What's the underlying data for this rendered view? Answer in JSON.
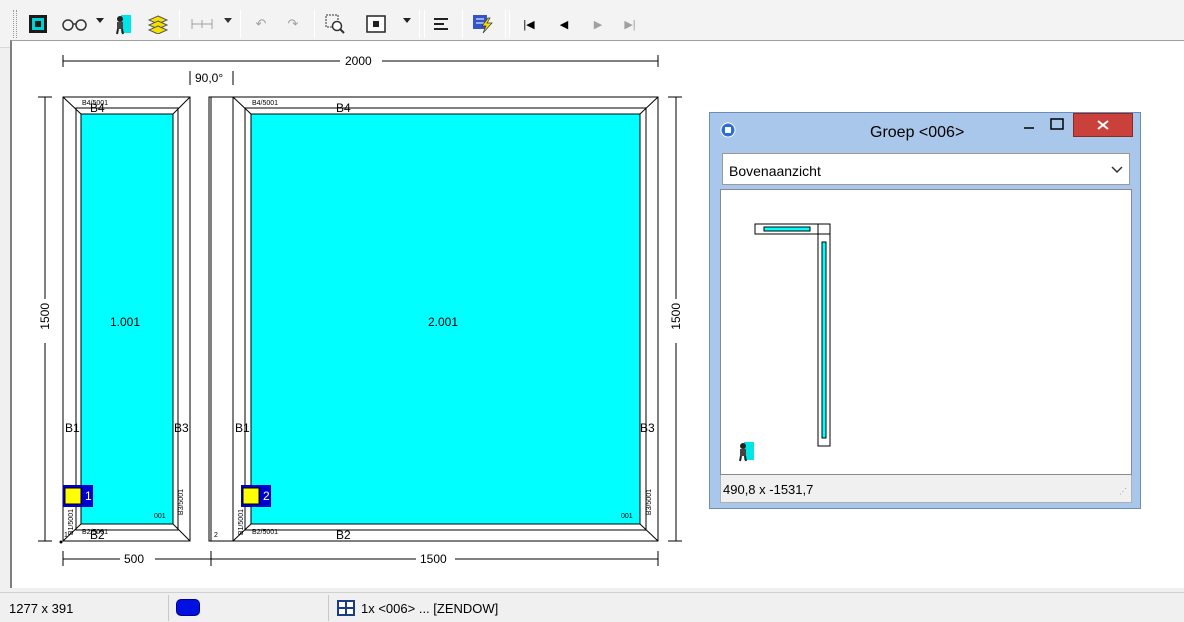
{
  "toolbar": {
    "buttons": [
      {
        "name": "frame-tool-icon",
        "glyph": "▣"
      },
      {
        "name": "glasses-icon",
        "glyph": "∞"
      },
      {
        "name": "person-view-icon",
        "glyph": "♙"
      },
      {
        "name": "layers-icon",
        "glyph": "≋"
      },
      {
        "name": "dimension-icon",
        "glyph": "⟷"
      },
      {
        "name": "undo-icon",
        "glyph": "↶"
      },
      {
        "name": "redo-icon",
        "glyph": "↷"
      },
      {
        "name": "zoom-select-icon",
        "glyph": "⌕"
      },
      {
        "name": "view-mode-icon",
        "glyph": "◘"
      },
      {
        "name": "align-icon",
        "glyph": "≡"
      },
      {
        "name": "calculate-icon",
        "glyph": "ϟ"
      },
      {
        "name": "first-icon",
        "glyph": "⏮"
      },
      {
        "name": "previous-icon",
        "glyph": "◀"
      },
      {
        "name": "next-icon",
        "glyph": "▶"
      },
      {
        "name": "last-icon",
        "glyph": "⏭"
      }
    ]
  },
  "drawing": {
    "dim_total_width": "2000",
    "dim_angle": "90,0°",
    "dim_height_left": "1500",
    "dim_height_right": "1500",
    "dim_width_left": "500",
    "dim_width_right": "1500",
    "panel1": {
      "label": "1.001",
      "b1": "B1",
      "b2": "B2",
      "b3": "B3",
      "b4": "B4",
      "code_top": "B4/5001",
      "code_bottom": "B2/5001",
      "code_left": "B1/5001",
      "code_right": "B3/5001",
      "small": "001",
      "number": "1"
    },
    "panel2": {
      "label": "2.001",
      "b1": "B1",
      "b2": "B2",
      "b3": "B3",
      "b4": "B4",
      "code_top": "B4/5001",
      "code_bottom": "B2/5001",
      "code_left": "B1/5001",
      "code_right": "B3/5001",
      "small": "001",
      "number": "2"
    },
    "corner_1": "1",
    "corner_2": "2"
  },
  "window": {
    "title": "Groep <006>",
    "view_select": "Bovenaanzicht",
    "coords": "490,8 x -1531,7"
  },
  "status": {
    "size": "1277 x 391",
    "info": "1x <006> ... [ZENDOW]"
  },
  "colors": {
    "glass": "#00ffff",
    "marker_yellow": "#ffff00",
    "marker_blue": "#0000cc",
    "close_red": "#c9413a",
    "window_frame": "#a9c7ea"
  }
}
